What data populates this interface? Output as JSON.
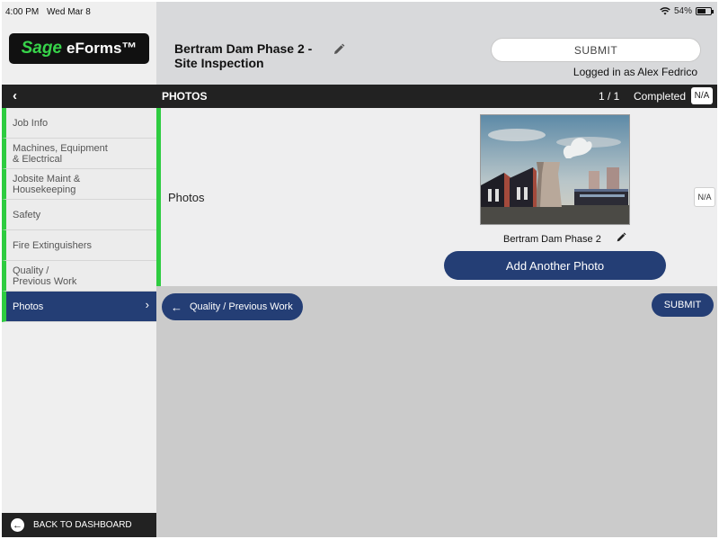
{
  "status_bar": {
    "time": "4:00 PM",
    "date": "Wed Mar 8",
    "battery": "54%"
  },
  "brand": {
    "logo_part1": "Sage",
    "logo_part2": "eForms™"
  },
  "header": {
    "title_line1": "Bertram Dam Phase 2 -",
    "title_line2": "Site Inspection",
    "submit_label": "SUBMIT",
    "logged_in_text": "Logged in as Alex Fedrico"
  },
  "navbar": {
    "back_glyph": "‹",
    "section_title": "PHOTOS",
    "page_count": "1 / 1",
    "status": "Completed",
    "na_label": "N/A"
  },
  "sidebar": {
    "items": [
      {
        "label": "Job Info",
        "active": false
      },
      {
        "label": "Machines, Equipment & Electrical",
        "active": false
      },
      {
        "label": "Jobsite Maint & Housekeeping",
        "active": false
      },
      {
        "label": "Safety",
        "active": false
      },
      {
        "label": "Fire Extinguishers",
        "active": false
      },
      {
        "label": "Quality / Previous Work",
        "active": false
      },
      {
        "label": "Photos",
        "active": true
      }
    ],
    "back_label": "BACK TO DASHBOARD"
  },
  "question": {
    "label": "Photos",
    "photo_caption": "Bertram Dam Phase 2",
    "add_photo_label": "Add Another Photo",
    "na_label": "N/A"
  },
  "footer": {
    "prev_label": "Quality / Previous Work",
    "submit_label": "SUBMIT"
  },
  "colors": {
    "accent_navy": "#243e75",
    "progress_green": "#2ecc40",
    "nav_dark": "#222222",
    "header_grey": "#d8d9db"
  },
  "icons": {
    "edit": "pencil-icon",
    "back": "chevron-left-icon",
    "active_chevron": "chevron-right-icon",
    "prev": "arrow-left-icon",
    "dashboard": "circle-arrow-left-icon"
  }
}
